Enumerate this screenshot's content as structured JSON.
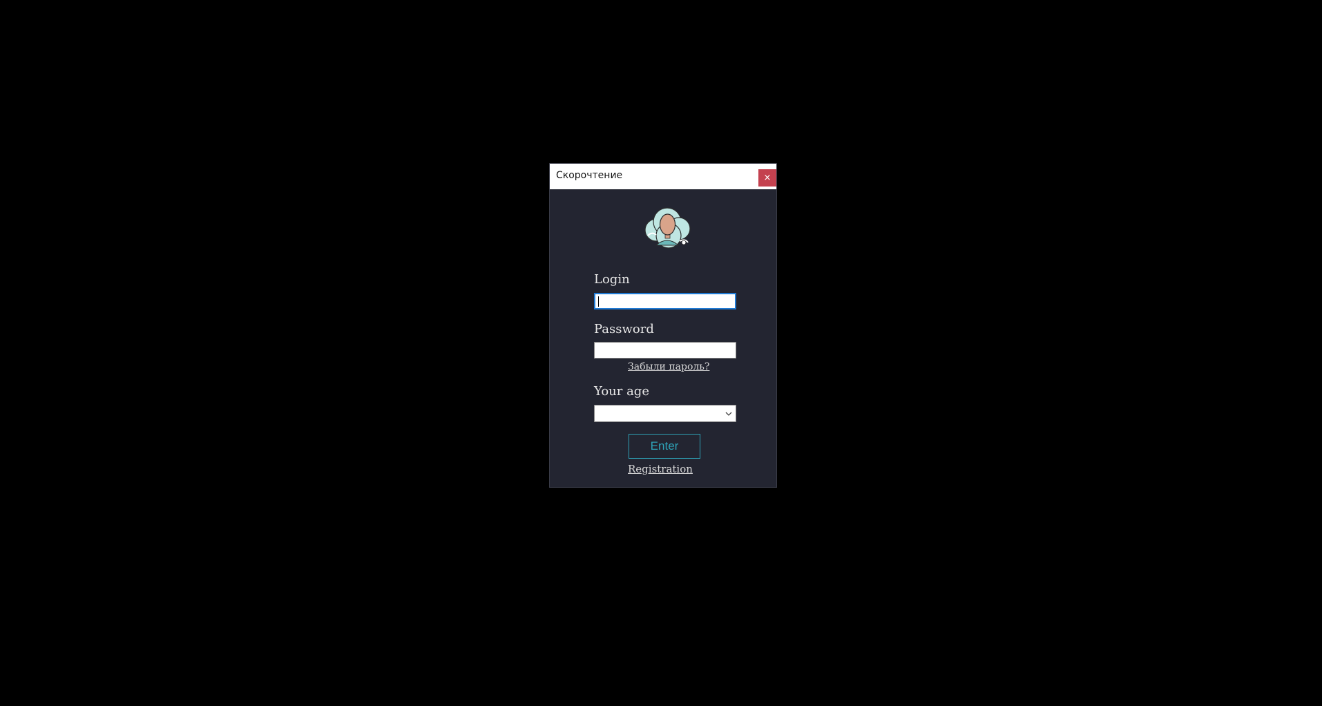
{
  "window": {
    "title": "Скорочтение",
    "close_label": "×"
  },
  "avatar": {
    "icon": "user-avatar-icon"
  },
  "form": {
    "login_label": "Login",
    "login_value": "",
    "password_label": "Password",
    "password_value": "",
    "forgot_link": "Забыли пароль?",
    "age_label": "Your age",
    "age_selected": "",
    "enter_label": "Enter",
    "register_link": "Registration"
  },
  "colors": {
    "window_bg": "#232531",
    "accent": "#2ea3b8",
    "close_bg": "#c4414f",
    "focus_border": "#1f7ad4"
  }
}
